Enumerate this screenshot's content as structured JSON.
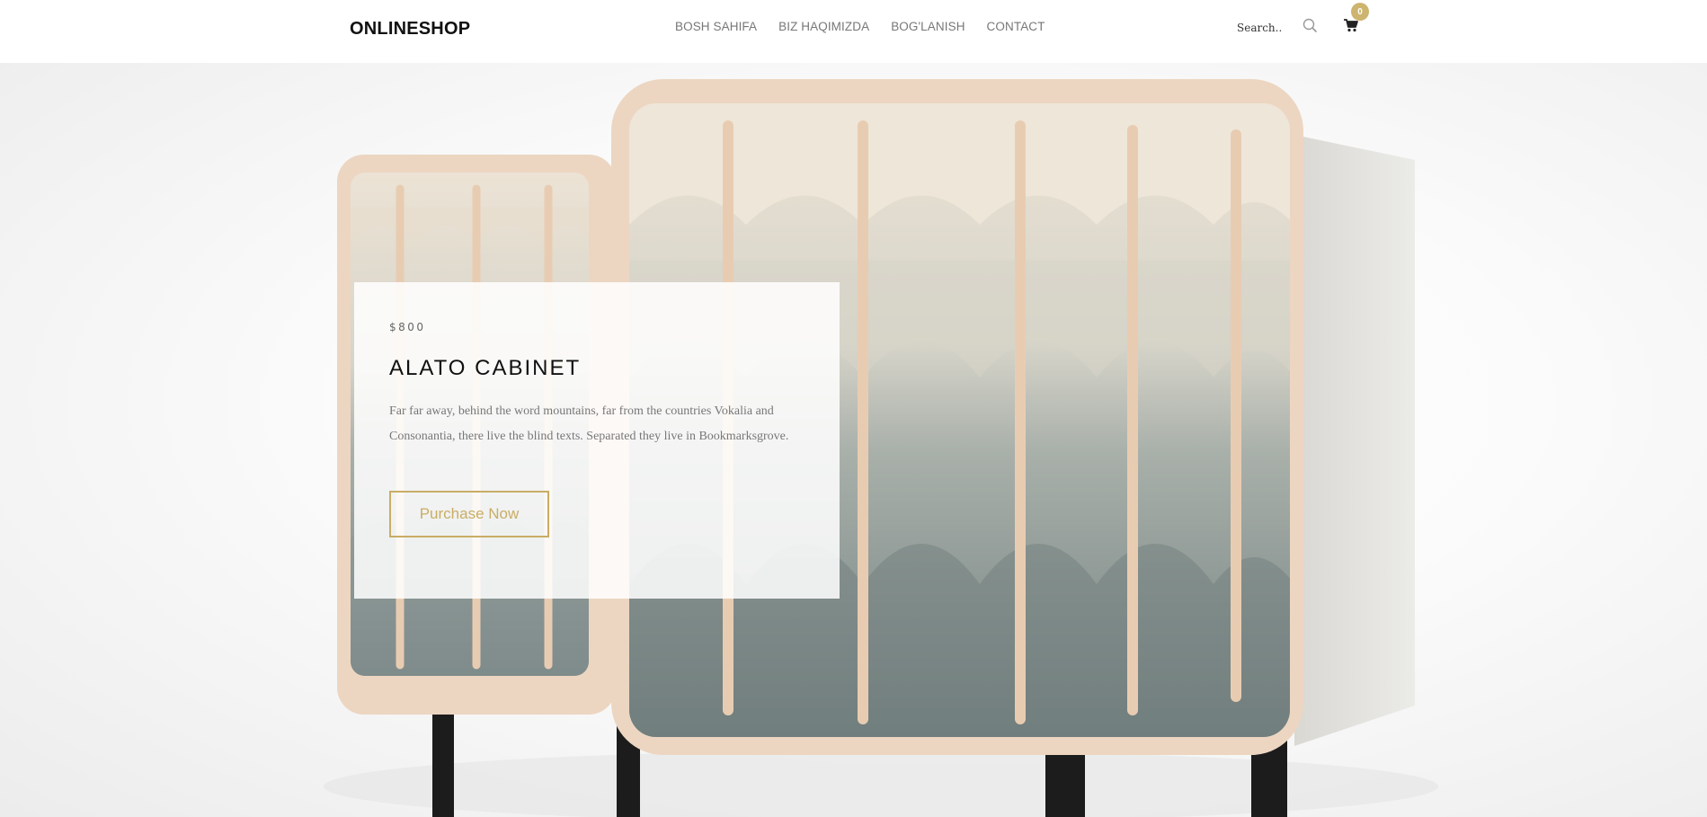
{
  "header": {
    "logo": "ONLINESHOP",
    "nav": [
      {
        "label": "BOSH SAHIFA"
      },
      {
        "label": "BIZ HAQIMIZDA"
      },
      {
        "label": "BOG'LANISH"
      },
      {
        "label": "CONTACT"
      }
    ],
    "search": {
      "placeholder": "Search.."
    },
    "cart": {
      "count": "0"
    }
  },
  "hero": {
    "price": "$800",
    "title": "ALATO CABINET",
    "description": "Far far away, behind the word mountains, far from the countries Vokalia and Consonantia, there live the blind texts. Separated they live in Bookmarksgrove.",
    "cta_label": "Purchase Now"
  },
  "colors": {
    "accent": "#c9ad65",
    "badge": "#cdb46f",
    "wood": "#efdcc9",
    "scale_light": "#ded8cc",
    "scale_dark": "#7e8c8c"
  }
}
